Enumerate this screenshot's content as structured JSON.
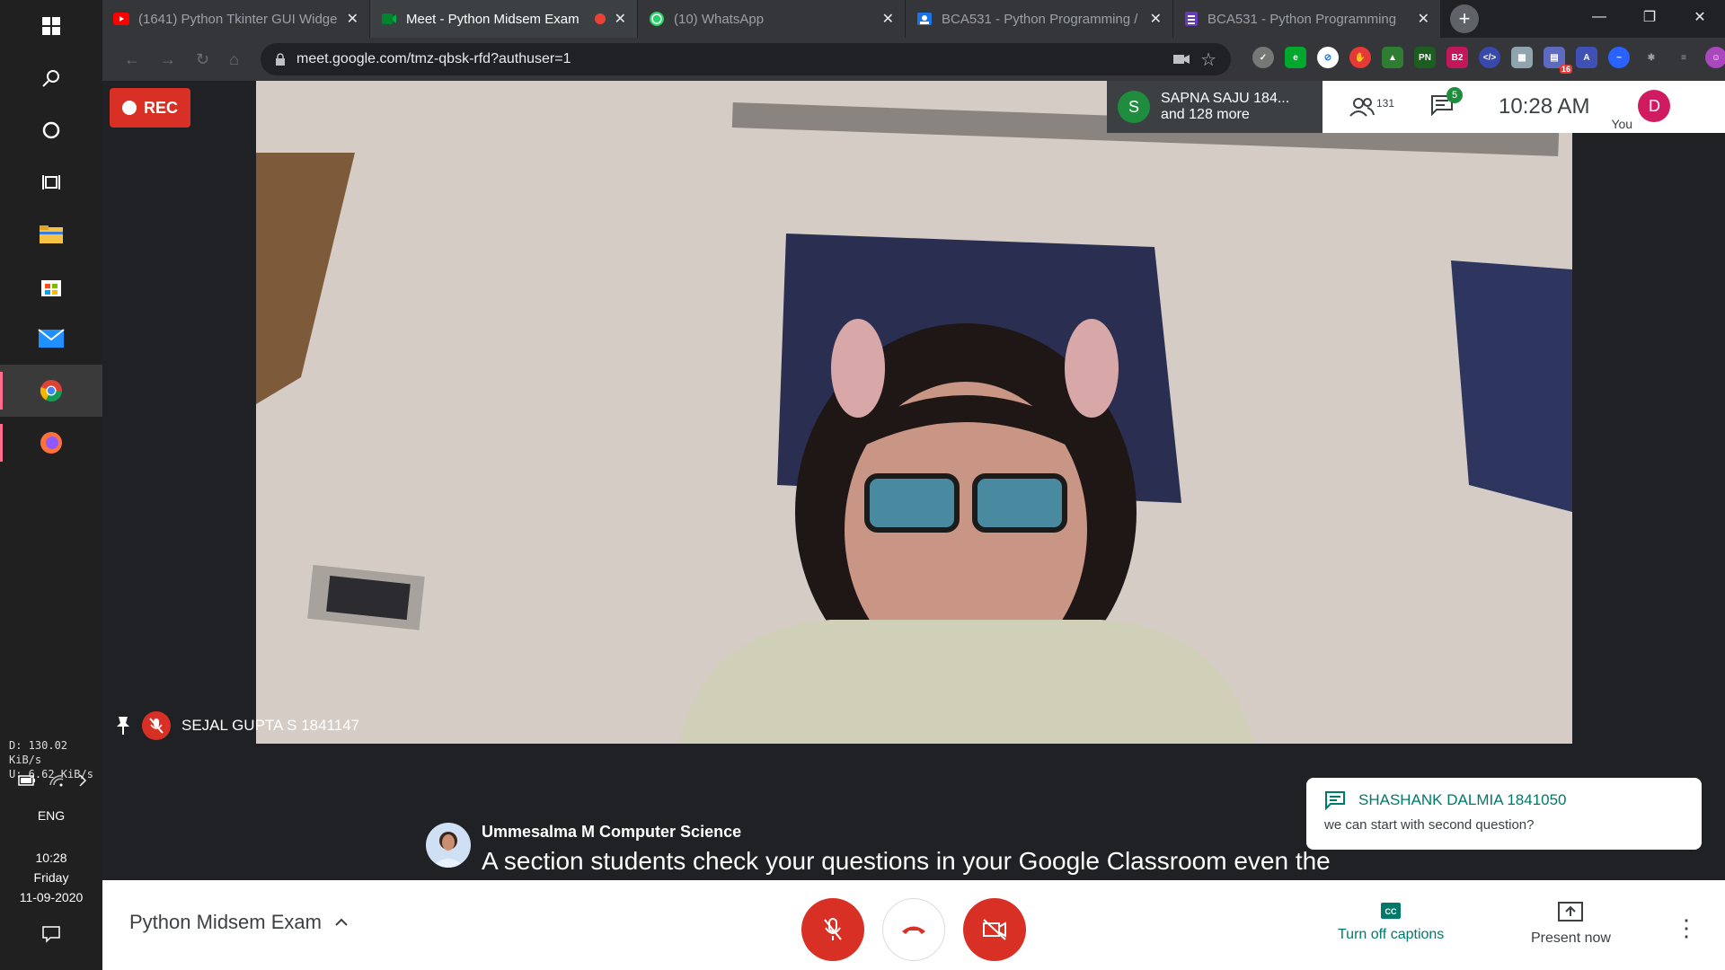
{
  "taskbar": {
    "net_down": "D:  130.02 KiB/s",
    "net_up": "U:    6.62 KiB/s",
    "lang": "ENG",
    "time": "10:28",
    "day": "Friday",
    "date": "11-09-2020"
  },
  "browser": {
    "tabs": [
      {
        "title": "(1641) Python Tkinter GUI Widge",
        "icon": "youtube-icon"
      },
      {
        "title": "Meet - Python Midsem Exam",
        "icon": "meet-icon",
        "active": true
      },
      {
        "title": "(10) WhatsApp",
        "icon": "whatsapp-icon"
      },
      {
        "title": "BCA531 - Python Programming /",
        "icon": "classroom-icon"
      },
      {
        "title": "BCA531 - Python Programming",
        "icon": "forms-icon"
      }
    ],
    "url": "meet.google.com/tmz-qbsk-rfd?authuser=1",
    "ext_badge": "16"
  },
  "meet": {
    "rec_label": "REC",
    "speaker_chip": {
      "initial": "S",
      "name": "SAPNA SAJU 184...",
      "more": "and 128 more"
    },
    "participants_count": "131",
    "chat_badge": "5",
    "time": "10:28  AM",
    "you_label": "You",
    "you_initial": "D",
    "pinned_name": "SEJAL GUPTA S 1841147",
    "chat_popup": {
      "sender": "SHASHANK DALMIA 1841050",
      "message": "we can start with second question?"
    },
    "caption": {
      "speaker": "Ummesalma M Computer Science",
      "text": "A section students check your questions in your Google Classroom even the"
    },
    "meeting_title": "Python Midsem Exam",
    "captions_label": "Turn off captions",
    "present_label": "Present now",
    "accent": "#00796b",
    "danger": "#d93025"
  }
}
